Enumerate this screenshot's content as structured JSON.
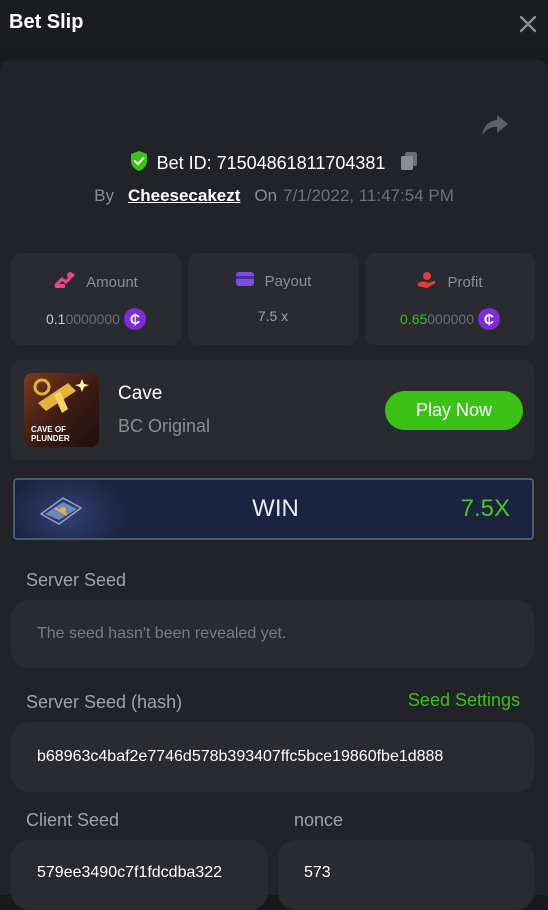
{
  "header": {
    "title": "Bet Slip"
  },
  "bet": {
    "id_text": "Bet ID: 71504861811704381",
    "by_label": "By",
    "user": "Cheesecakezt",
    "on_label": "On",
    "date": "7/1/2022, 11:47:54 PM"
  },
  "stats": {
    "amount": {
      "label": "Amount",
      "value_main": "0.1",
      "value_tail": "0000000",
      "color": "#e64a8a"
    },
    "payout": {
      "label": "Payout",
      "value": "7.5 x",
      "color": "#7a4ee0"
    },
    "profit": {
      "label": "Profit",
      "value_main": "0.65",
      "value_tail": "000000",
      "color": "#e23c3c"
    }
  },
  "coin_glyph": "₵",
  "game": {
    "name": "Cave",
    "provider": "BC Original",
    "thumb_line1": "CAVE OF",
    "thumb_line2": "PLUNDER",
    "play_label": "Play Now"
  },
  "result": {
    "label": "WIN",
    "multiplier": "7.5X"
  },
  "seeds": {
    "server_label": "Server Seed",
    "server_value": "The seed hasn't been revealed yet.",
    "hash_label": "Server Seed (hash)",
    "seed_settings": "Seed Settings",
    "hash_value": "b68963c4baf2e7746d578b393407ffc5bce19860fbe1d888",
    "client_label": "Client Seed",
    "client_value": "579ee3490c7f1fdcdba322",
    "nonce_label": "nonce",
    "nonce_value": "573"
  },
  "colors": {
    "accent_green": "#3bc117",
    "panel": "#222328",
    "card": "#2a2b31"
  }
}
